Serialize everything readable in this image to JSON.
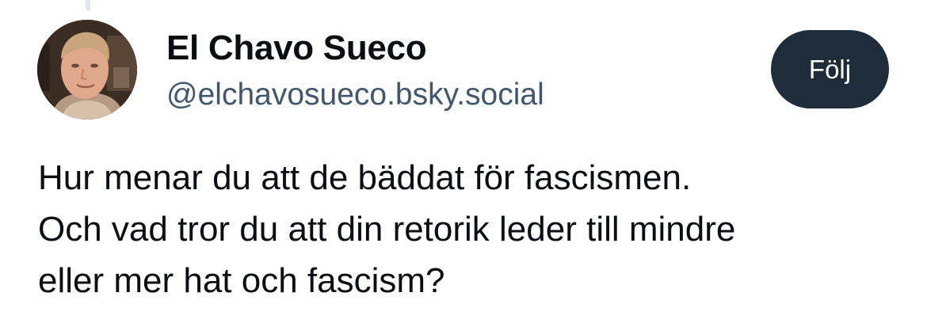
{
  "post": {
    "author": {
      "display_name": "El Chavo Sueco",
      "handle": "@elchavosueco.bsky.social",
      "avatar_icon": "profile-photo"
    },
    "follow_label": "Följ",
    "text_lines": [
      "Hur menar du att de bäddat för fascismen.",
      "Och vad tror du att din retorik leder till mindre",
      "eller mer hat och fascism?"
    ]
  },
  "colors": {
    "follow_button_bg": "#1f2c3a",
    "handle_text": "#42576c",
    "body_text": "#0b0f14",
    "thread_line": "#e3e7ee"
  }
}
